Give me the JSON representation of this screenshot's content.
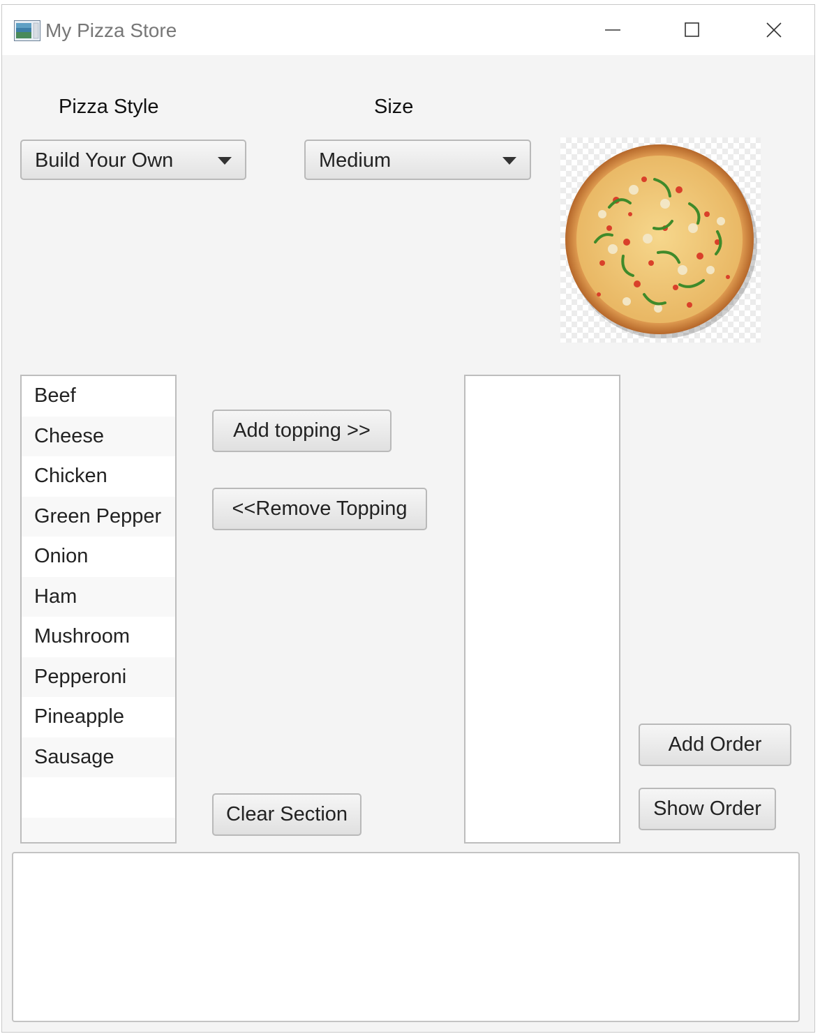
{
  "window": {
    "title": "My Pizza Store"
  },
  "labels": {
    "pizza_style": "Pizza Style",
    "size": "Size"
  },
  "combos": {
    "pizza_style_value": "Build Your Own",
    "size_value": "Medium"
  },
  "toppings": {
    "available": [
      "Beef",
      "Cheese",
      "Chicken",
      "Green Pepper",
      "Onion",
      "Ham",
      "Mushroom",
      "Pepperoni",
      "Pineapple",
      "Sausage"
    ],
    "selected": []
  },
  "buttons": {
    "add_topping": "Add topping >>",
    "remove_topping": "<<Remove Topping",
    "clear_section": "Clear Section",
    "add_order": "Add Order",
    "show_order": "Show Order"
  },
  "output_text": "",
  "colors": {
    "window_bg": "#f4f4f4",
    "titlebar_bg": "#ffffff",
    "title_text": "#777777"
  },
  "icons": {
    "app": "app-window-icon",
    "minimize": "minimize-icon",
    "maximize": "maximize-icon",
    "close": "close-icon",
    "dropdown": "chevron-down-icon"
  }
}
